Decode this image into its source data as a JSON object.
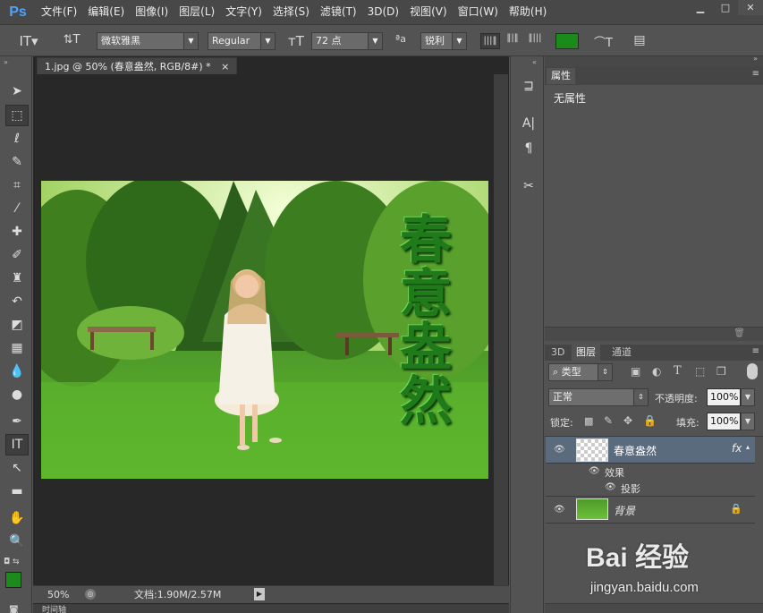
{
  "app": {
    "logo": "Ps"
  },
  "menu": [
    "文件(F)",
    "编辑(E)",
    "图像(I)",
    "图层(L)",
    "文字(Y)",
    "选择(S)",
    "滤镜(T)",
    "3D(D)",
    "视图(V)",
    "窗口(W)",
    "帮助(H)"
  ],
  "options": {
    "font_family": "微软雅黑",
    "font_style": "Regular",
    "font_size": "72 点",
    "aa_symbol": "ªa",
    "antialias": "锐利",
    "text_color": "#1a8a1a"
  },
  "document": {
    "tab_title": "1.jpg @ 50% (春意盎然, RGB/8#) *",
    "tab_close": "×",
    "overlay_text": [
      "春",
      "意",
      "盎",
      "然"
    ]
  },
  "status": {
    "zoom": "50%",
    "doc_info": "文档:1.90M/2.57M"
  },
  "properties": {
    "tab": "属性",
    "content": "无属性"
  },
  "layers_panel": {
    "tabs": [
      "3D",
      "图层",
      "通道"
    ],
    "filter_kind": "类型",
    "blend_mode": "正常",
    "opacity_label": "不透明度:",
    "opacity_value": "100%",
    "lock_label": "锁定:",
    "fill_label": "填充:",
    "fill_value": "100%",
    "layers": [
      {
        "name": "春意盎然",
        "fx": "fx"
      },
      {
        "name": "效果"
      },
      {
        "name": "投影"
      },
      {
        "name": "背景"
      }
    ]
  },
  "bottom_tab": "时间轴",
  "watermark": {
    "brand": "Bai 经验",
    "url": "jingyan.baidu.com"
  },
  "colors": {
    "foreground": "#1c8a1c",
    "background": "#ffffff",
    "selected_layer": "#5a6b7e"
  }
}
